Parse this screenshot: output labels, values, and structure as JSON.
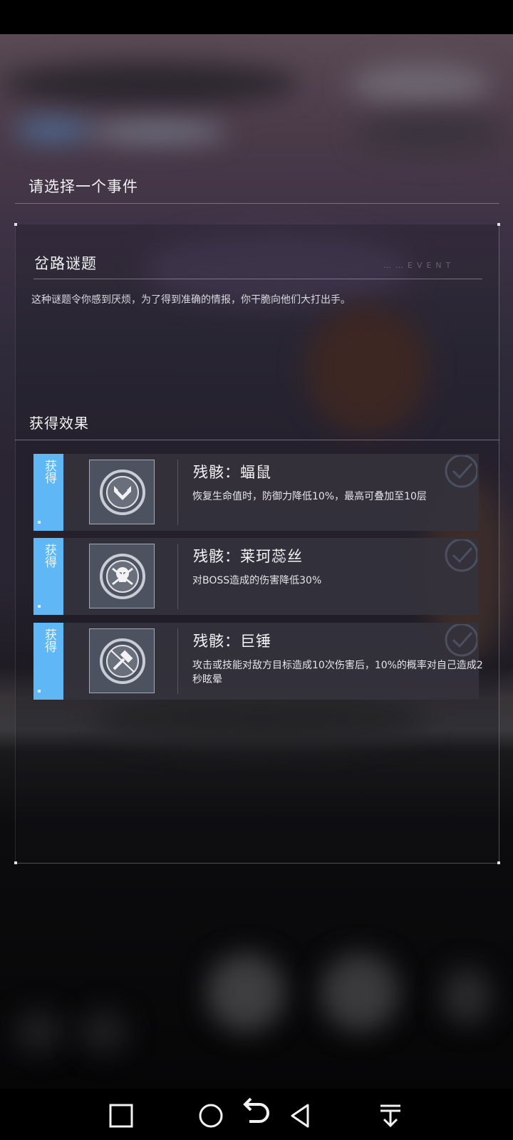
{
  "dialog": {
    "title": "请选择一个事件",
    "event": {
      "name": "岔路谜题",
      "tag": "……EVENT",
      "description": "这种谜题令你感到厌烦，为了得到准确的情报，你干脆向他们大打出手。"
    },
    "effects_title": "获得效果",
    "effects": [
      {
        "badge": "获得",
        "icon": "shield-heart-icon",
        "name": "残骸：蝠鼠",
        "description": "恢复生命值时，防御力降低10%，最高可叠加至10层"
      },
      {
        "badge": "获得",
        "icon": "skull-crossbones-icon",
        "name": "残骸：莱珂蕊丝",
        "description": "对BOSS造成的伤害降低30%"
      },
      {
        "badge": "获得",
        "icon": "hammer-crossed-icon",
        "name": "残骸：巨锤",
        "description": "攻击或技能对敌方目标造成10次伤害后，10%的概率对自己造成2秒眩晕"
      }
    ]
  },
  "navbar": {
    "buttons": [
      "recents-button",
      "home-button",
      "back-arrow-button",
      "back-button",
      "notification-pulldown-button"
    ]
  },
  "colors": {
    "badge": "#5fb8f5",
    "card": "#34323c"
  }
}
